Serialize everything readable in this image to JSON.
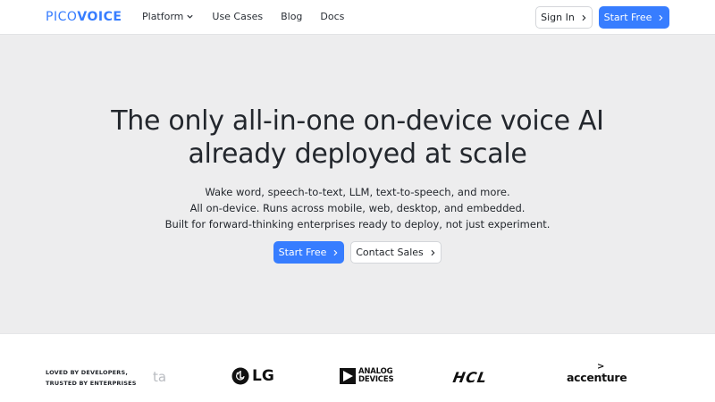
{
  "brand": {
    "logo_thin": "PICO",
    "logo_bold": "VOICE"
  },
  "nav": {
    "items": [
      {
        "label": "Platform"
      },
      {
        "label": "Use Cases"
      },
      {
        "label": "Blog"
      },
      {
        "label": "Docs"
      }
    ],
    "sign_in": "Sign In",
    "start_free": "Start Free"
  },
  "hero": {
    "headline_line1": "The only all-in-one on-device voice AI",
    "headline_line2": "already deployed at scale",
    "sub_line1": "Wake word, speech-to-text, LLM, text-to-speech, and more.",
    "sub_line2": "All on-device. Runs across mobile, web, desktop, and embedded.",
    "sub_line3": "Built for forward-thinking enterprises ready to deploy, not just experiment.",
    "cta_primary": "Start Free",
    "cta_secondary": "Contact Sales"
  },
  "logos": {
    "tagline_line1": "LOVED BY DEVELOPERS,",
    "tagline_line2": "TRUSTED BY ENTERPRISES",
    "partial": "ta",
    "items": [
      {
        "name": "LG",
        "text": "LG"
      },
      {
        "name": "Analog Devices",
        "line1": "ANALOG",
        "line2": "DEVICES"
      },
      {
        "name": "HCL",
        "text": "HCL"
      },
      {
        "name": "accenture",
        "text": "accenture",
        "mark": ">"
      }
    ]
  },
  "colors": {
    "accent": "#377dff",
    "page_bg": "#ededee",
    "text": "#23272d"
  },
  "icons": [
    "chevron-down-icon",
    "chevron-right-icon",
    "lg-face-icon",
    "adi-triangle-icon"
  ]
}
